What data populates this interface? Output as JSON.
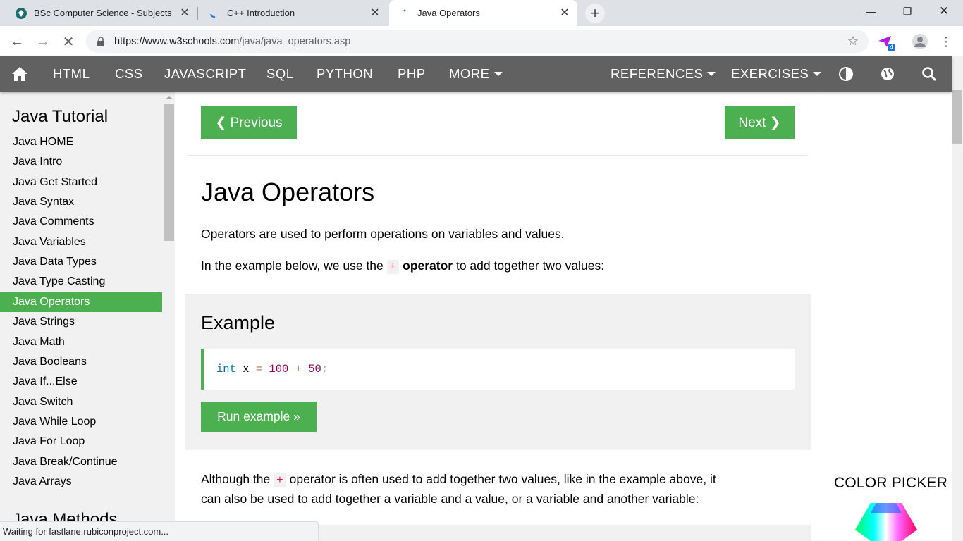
{
  "browser": {
    "tabs": [
      {
        "title": "BSc Computer Science - Subjects",
        "active": false
      },
      {
        "title": "C++ Introduction",
        "active": false
      },
      {
        "title": "Java Operators",
        "active": true
      }
    ],
    "new_tab": "+",
    "url_host": "https://www.w3schools.com",
    "url_path": "/java/java_operators.asp",
    "extension_badge": "4",
    "status_text": "Waiting for fastlane.rubiconproject.com..."
  },
  "topnav": {
    "items": [
      "HTML",
      "CSS",
      "JAVASCRIPT",
      "SQL",
      "PYTHON",
      "PHP",
      "MORE",
      "REFERENCES",
      "EXERCISES"
    ]
  },
  "sidebar": {
    "heading": "Java Tutorial",
    "items": [
      "Java HOME",
      "Java Intro",
      "Java Get Started",
      "Java Syntax",
      "Java Comments",
      "Java Variables",
      "Java Data Types",
      "Java Type Casting",
      "Java Operators",
      "Java Strings",
      "Java Math",
      "Java Booleans",
      "Java If...Else",
      "Java Switch",
      "Java While Loop",
      "Java For Loop",
      "Java Break/Continue",
      "Java Arrays"
    ],
    "active_index": 8,
    "next_heading": "Java Methods"
  },
  "main": {
    "prev_label": "❮ Previous",
    "next_label": "Next ❯",
    "title": "Java Operators",
    "intro": "Operators are used to perform operations on variables and values.",
    "p2_before": "In the example below, we use the ",
    "p2_code": "+",
    "p2_bold": "operator",
    "p2_after": " to add together two values:",
    "example_heading": "Example",
    "code": {
      "kw": "int",
      "var": " x ",
      "eq": "=",
      "n1": " 100 ",
      "plus": "+",
      "n2": " 50",
      "semi": ";"
    },
    "run_label": "Run example »",
    "p3_before": "Although the ",
    "p3_code": "+",
    "p3_line1_after": " operator is often used to add together two values, like in the example above, it",
    "p3_line2": "can also be used to add together a variable and a value, or a variable and another variable:"
  },
  "right": {
    "color_picker": "COLOR PICKER"
  },
  "colors": {
    "green": "#4caf50",
    "nav": "#616161"
  }
}
